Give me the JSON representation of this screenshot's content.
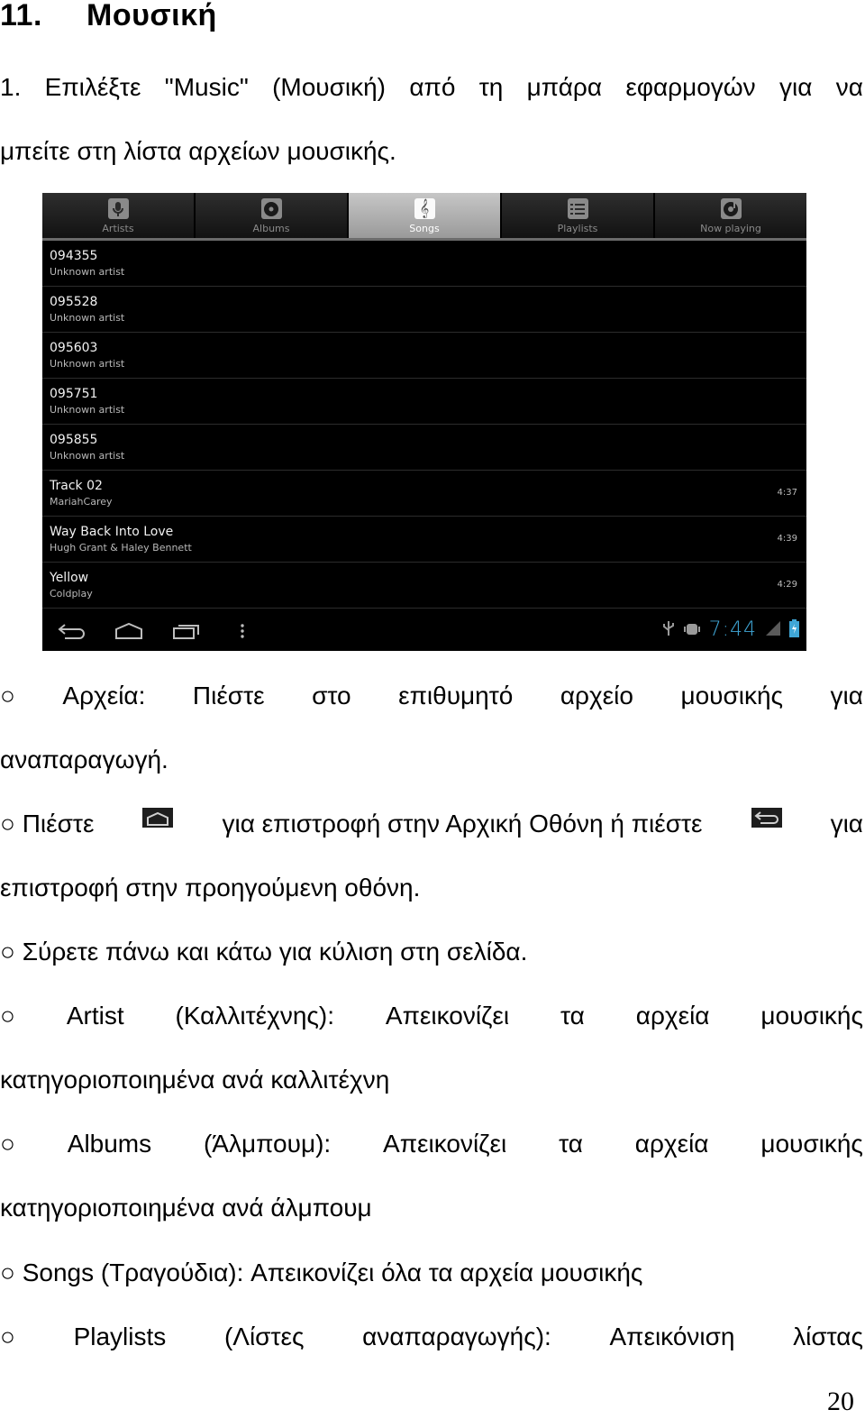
{
  "heading": {
    "number": "11.",
    "title": "Μουσική"
  },
  "intro": {
    "line1_words": [
      "1.",
      "Επιλέξτε",
      "\"Music\"",
      "(Μουσική)",
      "από",
      "τη",
      "μπάρα",
      "εφαρμογών",
      "για",
      "να"
    ],
    "line2": "μπείτε στη λίστα αρχείων μουσικής."
  },
  "screenshot": {
    "tabs": [
      {
        "label": "Artists",
        "icon": "microphone-icon",
        "active": false
      },
      {
        "label": "Albums",
        "icon": "album-disc-icon",
        "active": false
      },
      {
        "label": "Songs",
        "icon": "treble-clef-icon",
        "active": true
      },
      {
        "label": "Playlists",
        "icon": "playlist-icon",
        "active": false
      },
      {
        "label": "Now playing",
        "icon": "now-playing-icon",
        "active": false
      }
    ],
    "songs": [
      {
        "title": "094355",
        "artist": "Unknown artist",
        "duration": ""
      },
      {
        "title": "095528",
        "artist": "Unknown artist",
        "duration": ""
      },
      {
        "title": "095603",
        "artist": "Unknown artist",
        "duration": ""
      },
      {
        "title": "095751",
        "artist": "Unknown artist",
        "duration": ""
      },
      {
        "title": "095855",
        "artist": "Unknown artist",
        "duration": ""
      },
      {
        "title": "Track 02",
        "artist": "MariahCarey",
        "duration": "4:37"
      },
      {
        "title": "Way Back Into Love",
        "artist": "Hugh Grant & Haley Bennett",
        "duration": "4:39"
      },
      {
        "title": "Yellow",
        "artist": "Coldplay",
        "duration": "4:29"
      }
    ],
    "status_bar": {
      "time": "7:44",
      "accent_color": "#3fa6d6"
    },
    "nav_buttons": [
      "back-icon",
      "home-icon",
      "recent-apps-icon",
      "menu-icon"
    ]
  },
  "bullets": {
    "files_line1": [
      "○",
      "Αρχεία:",
      "Πιέστε",
      "στο",
      "επιθυμητό",
      "αρχείο",
      "μουσικής",
      "για"
    ],
    "files_line2": "αναπαραγωγή.",
    "press_a": "○ Πιέστε",
    "press_b": "για επιστροφή στην Αρχική Οθόνη ή πιέστε",
    "press_c": "για",
    "press_line2": "επιστροφή στην προηγούμενη οθόνη.",
    "scroll": "○ Σύρετε πάνω και κάτω για κύλιση στη σελίδα.",
    "artist_line1": [
      "○",
      "Artist",
      "(Καλλιτέχνης):",
      "Απεικονίζει",
      "τα",
      "αρχεία",
      "μουσικής"
    ],
    "artist_line2": "κατηγοριοποιημένα ανά καλλιτέχνη",
    "albums_line1": [
      "○",
      "Albums",
      "(Άλμπουμ):",
      "Απεικονίζει",
      "τα",
      "αρχεία",
      "μουσικής"
    ],
    "albums_line2": "κατηγοριοποιημένα ανά άλμπουμ",
    "songs": "○ Songs (Τραγούδια): Απεικονίζει όλα τα αρχεία μουσικής",
    "playlists_line1": [
      "○",
      "Playlists",
      "(Λίστες",
      "αναπαραγωγής):",
      "Απεικόνιση",
      "λίστας"
    ]
  },
  "page_number": "20"
}
